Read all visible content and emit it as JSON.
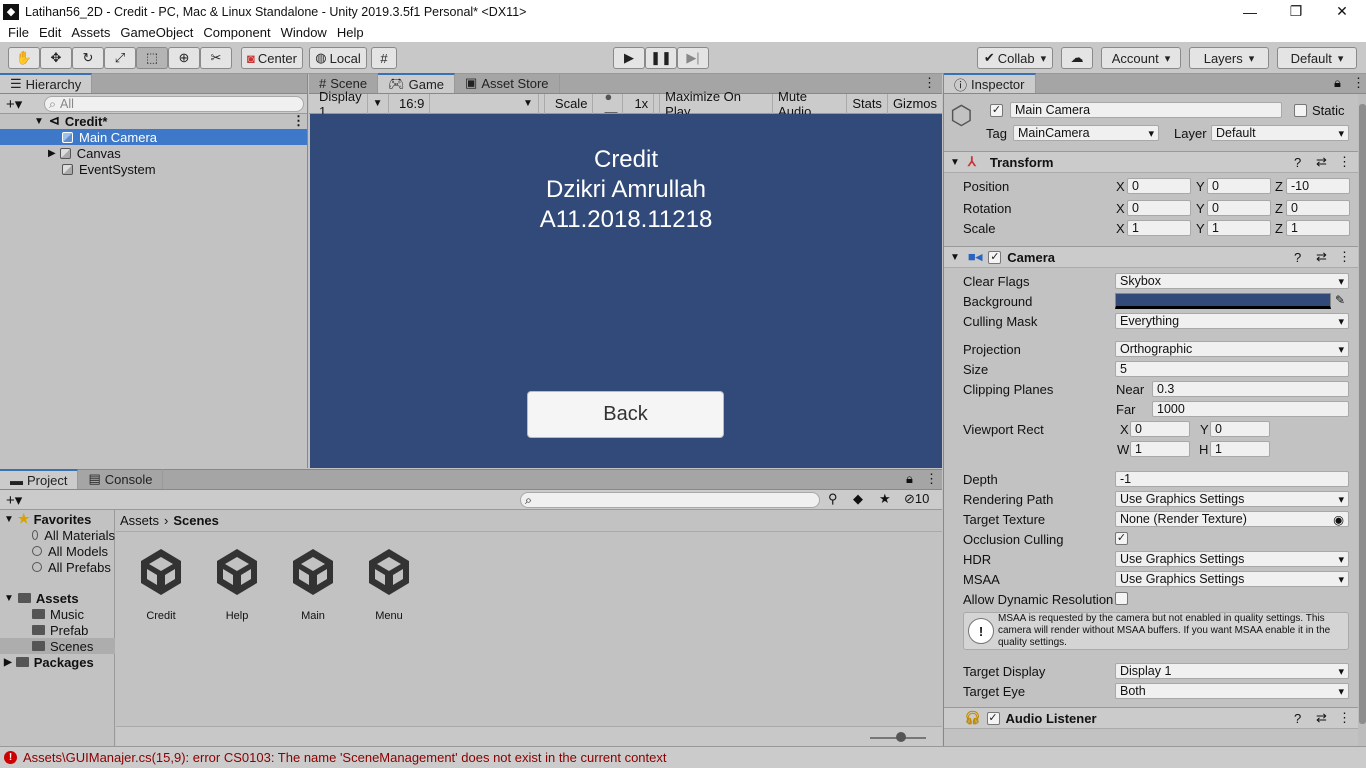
{
  "window": {
    "title": "Latihan56_2D - Credit - PC, Mac & Linux Standalone - Unity 2019.3.5f1 Personal* <DX11>",
    "logo": "unity-logo-icon",
    "minimize": "—",
    "maximize": "❐",
    "close": "✕"
  },
  "menu": [
    "File",
    "Edit",
    "Assets",
    "GameObject",
    "Component",
    "Window",
    "Help"
  ],
  "toolbar": {
    "pivot": "Center",
    "space": "Local",
    "collab": "Collab",
    "account": "Account",
    "layers": "Layers",
    "layout": "Default"
  },
  "hierarchy": {
    "tab": "Hierarchy",
    "search_placeholder": "All",
    "scene": "Credit*",
    "items": [
      "Main Camera",
      "Canvas",
      "EventSystem"
    ],
    "selected": "Main Camera"
  },
  "gameview": {
    "tabs": [
      "Scene",
      "Game",
      "Asset Store"
    ],
    "active_tab": "Game",
    "display": "Display 1",
    "aspect": "16:9",
    "scale_label": "Scale",
    "scale_value": "1x",
    "maximize": "Maximize On Play",
    "mute": "Mute Audio",
    "stats": "Stats",
    "gizmos": "Gizmos",
    "background_color": "#324a7a",
    "text_line1": "Credit",
    "text_line2": "Dzikri Amrullah",
    "text_line3": "A11.2018.11218",
    "back_button": "Back"
  },
  "project": {
    "tabs": [
      "Project",
      "Console"
    ],
    "hidden_count": "10",
    "breadcrumb_root": "Assets",
    "breadcrumb_sep": "›",
    "breadcrumb_current": "Scenes",
    "favorites_label": "Favorites",
    "favorites": [
      "All Materials",
      "All Models",
      "All Prefabs"
    ],
    "assets_label": "Assets",
    "folders": [
      "Music",
      "Prefab",
      "Scenes"
    ],
    "packages_label": "Packages",
    "scene_assets": [
      "Credit",
      "Help",
      "Main",
      "Menu"
    ]
  },
  "inspector": {
    "tab": "Inspector",
    "object_name": "Main Camera",
    "static_label": "Static",
    "tag_label": "Tag",
    "tag": "MainCamera",
    "layer_label": "Layer",
    "layer": "Default",
    "transform": {
      "title": "Transform",
      "position_label": "Position",
      "position": [
        "0",
        "0",
        "-10"
      ],
      "rotation_label": "Rotation",
      "rotation": [
        "0",
        "0",
        "0"
      ],
      "scale_label": "Scale",
      "scale": [
        "1",
        "1",
        "1"
      ]
    },
    "camera": {
      "title": "Camera",
      "clear_flags_label": "Clear Flags",
      "clear_flags": "Skybox",
      "background_label": "Background",
      "background_color": "#324a7a",
      "culling_mask_label": "Culling Mask",
      "culling_mask": "Everything",
      "projection_label": "Projection",
      "projection": "Orthographic",
      "size_label": "Size",
      "size": "5",
      "clipping_label": "Clipping Planes",
      "near_label": "Near",
      "near": "0.3",
      "far_label": "Far",
      "far": "1000",
      "viewport_label": "Viewport Rect",
      "vx": "0",
      "vy": "0",
      "vw": "1",
      "vh": "1",
      "depth_label": "Depth",
      "depth": "-1",
      "rendering_path_label": "Rendering Path",
      "rendering_path": "Use Graphics Settings",
      "target_texture_label": "Target Texture",
      "target_texture": "None (Render Texture)",
      "occlusion_label": "Occlusion Culling",
      "hdr_label": "HDR",
      "hdr": "Use Graphics Settings",
      "msaa_label": "MSAA",
      "msaa": "Use Graphics Settings",
      "dynamic_res_label": "Allow Dynamic Resolution",
      "warning": "MSAA is requested by the camera but not enabled in quality settings. This camera will render without MSAA buffers. If you want MSAA enable it in the quality settings.",
      "target_display_label": "Target Display",
      "target_display": "Display 1",
      "target_eye_label": "Target Eye",
      "target_eye": "Both"
    },
    "audio_listener": {
      "title": "Audio Listener"
    }
  },
  "status": {
    "error": "Assets\\GUIManajer.cs(15,9): error CS0103: The name 'SceneManagement' does not exist in the current context"
  }
}
